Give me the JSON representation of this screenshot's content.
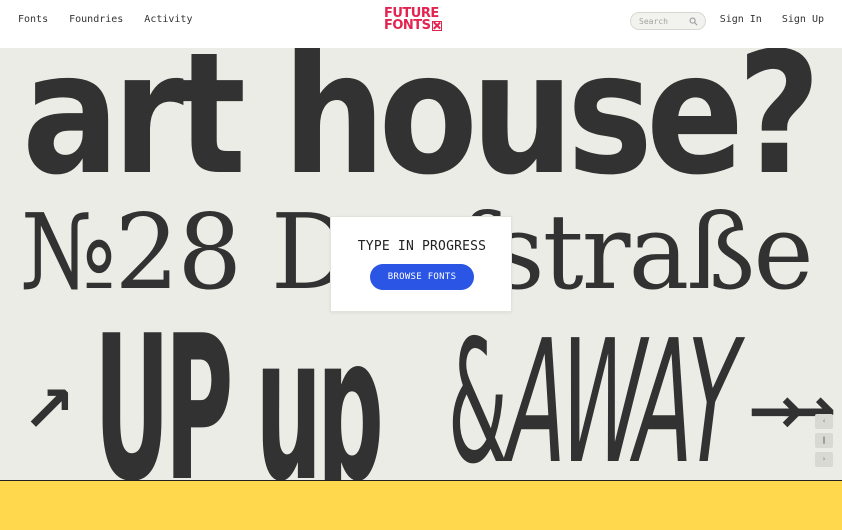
{
  "nav": {
    "left": [
      "Fonts",
      "Foundries",
      "Activity"
    ],
    "right": [
      "Sign In",
      "Sign Up"
    ]
  },
  "logo": {
    "line1": "FUTURE",
    "line2": "FONTS"
  },
  "search": {
    "placeholder": "Search",
    "icon": "search-icon"
  },
  "hero": {
    "line1": "art house?",
    "line2": "№28 Dorfstraße",
    "line3_arrow": "↗",
    "line3_up": "UP up",
    "line3_amp": "&",
    "line3_away": "AWAY",
    "line3_arrows": "→→"
  },
  "card": {
    "title": "TYPE IN PROGRESS",
    "button": "BROWSE FONTS"
  },
  "slide_controls": {
    "prev": "‹",
    "pause": "‖",
    "next": "›"
  },
  "colors": {
    "brand": "#e32450",
    "accent_button": "#2a55e5",
    "hero_bg": "#ecece6",
    "footer_band": "#ffd84e",
    "ink": "#323232"
  }
}
